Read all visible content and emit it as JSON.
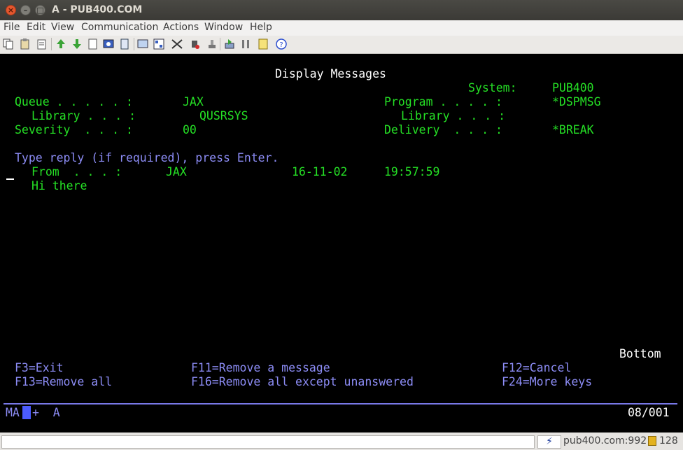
{
  "window": {
    "title": "A - PUB400.COM",
    "close_glyph": "×",
    "min_glyph": "–",
    "max_glyph": "□"
  },
  "menu": [
    "File",
    "Edit",
    "View",
    "Communication",
    "Actions",
    "Window",
    "Help"
  ],
  "toolbar_icons": [
    "copy-icon",
    "paste-icon",
    "paste-list-icon",
    "send-icon",
    "receive-icon",
    "print-screen-icon",
    "keyboard-map-icon",
    "macro-icon",
    "display-icon",
    "calculator-icon",
    "stop-icon",
    "record-icon",
    "pause-icon",
    "play-icon",
    "settings-icon",
    "notes-icon",
    "help-icon"
  ],
  "screen": {
    "title": "Display Messages",
    "system_label": "System:",
    "system_value": "PUB400",
    "queue_label": "Queue . . . . . :",
    "queue_value": "JAX",
    "queue_library_label": "Library . . . :",
    "queue_library_value": "QUSRSYS",
    "severity_label": "Severity  . . . :",
    "severity_value": "00",
    "program_label": "Program . . . . :",
    "program_value": "*DSPMSG",
    "program_library_label": "Library . . . :",
    "delivery_label": "Delivery  . . . :",
    "delivery_value": "*BREAK",
    "instruction": "Type reply (if required), press Enter.",
    "from_label": "From  . . . :",
    "from_user": "JAX",
    "from_date": "16-11-02",
    "from_time": "19:57:59",
    "message_text": "Hi there",
    "more_indicator": "Bottom",
    "function_keys": {
      "f3": "F3=Exit",
      "f11": "F11=Remove a message",
      "f12": "F12=Cancel",
      "f13": "F13=Remove all",
      "f16": "F16=Remove all except unanswered",
      "f24": "F24=More keys"
    }
  },
  "oia": {
    "mode": "MA",
    "mode_tail": "+  A",
    "cursor_position": "08/001"
  },
  "statusbar": {
    "conn_glyph": "⚡",
    "host": "pub400.com:992",
    "encryption": "128"
  }
}
